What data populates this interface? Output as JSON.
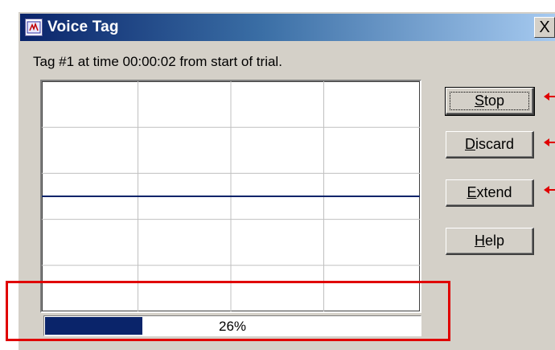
{
  "window": {
    "title": "Voice Tag",
    "close_label": "X",
    "app_icon": "voice-tag-app-icon"
  },
  "status": {
    "message": "Tag #1 at time 00:00:02 from start of trial."
  },
  "waveform": {
    "grid_columns": 4,
    "grid_rows": 5,
    "signal_level": 0.0
  },
  "progress": {
    "percent": 26,
    "label": "26%"
  },
  "buttons": {
    "stop": {
      "mnemonic": "S",
      "rest": "top"
    },
    "discard": {
      "mnemonic": "D",
      "rest": "iscard"
    },
    "extend": {
      "mnemonic": "E",
      "rest": "xtend"
    },
    "help": {
      "mnemonic": "H",
      "rest": "elp"
    }
  },
  "colors": {
    "annotation": "#e00000",
    "progress_fill": "#0a246a",
    "signal_line": "#0a246a"
  }
}
